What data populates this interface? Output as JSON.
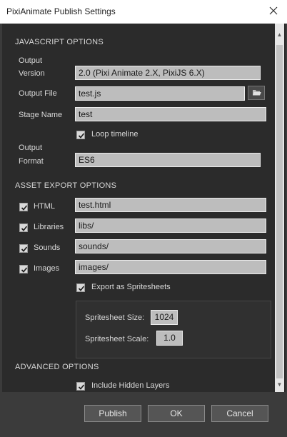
{
  "window": {
    "title": "PixiAnimate Publish Settings"
  },
  "js_options": {
    "header": "JAVASCRIPT OPTIONS",
    "output_version": {
      "label_line1": "Output",
      "label_line2": "Version",
      "value": "2.0 (Pixi Animate 2.X, PixiJS 6.X)"
    },
    "output_file": {
      "label": "Output File",
      "value": "test.js"
    },
    "stage_name": {
      "label": "Stage Name",
      "value": "test"
    },
    "loop_timeline": {
      "label": "Loop timeline",
      "checked": true
    },
    "output_format": {
      "label_line1": "Output",
      "label_line2": "Format",
      "value": "ES6"
    }
  },
  "asset_options": {
    "header": "ASSET EXPORT OPTIONS",
    "html": {
      "label": "HTML",
      "checked": true,
      "value": "test.html"
    },
    "libraries": {
      "label": "Libraries",
      "checked": true,
      "value": "libs/"
    },
    "sounds": {
      "label": "Sounds",
      "checked": true,
      "value": "sounds/"
    },
    "images": {
      "label": "Images",
      "checked": true,
      "value": "images/"
    },
    "spritesheets": {
      "label": "Export as Spritesheets",
      "checked": true
    },
    "spritesheet_size": {
      "label": "Spritesheet Size:",
      "value": "1024"
    },
    "spritesheet_scale": {
      "label": "Spritesheet Scale:",
      "value": "1.0"
    }
  },
  "advanced_options": {
    "header": "ADVANCED OPTIONS",
    "hidden_layers": {
      "label": "Include Hidden Layers",
      "checked": true
    }
  },
  "buttons": {
    "publish": "Publish",
    "ok": "OK",
    "cancel": "Cancel"
  },
  "colors": {
    "background": "#3b3b3b",
    "panel": "#2b2b2b",
    "field": "#bdbdbd",
    "button": "#555555"
  }
}
